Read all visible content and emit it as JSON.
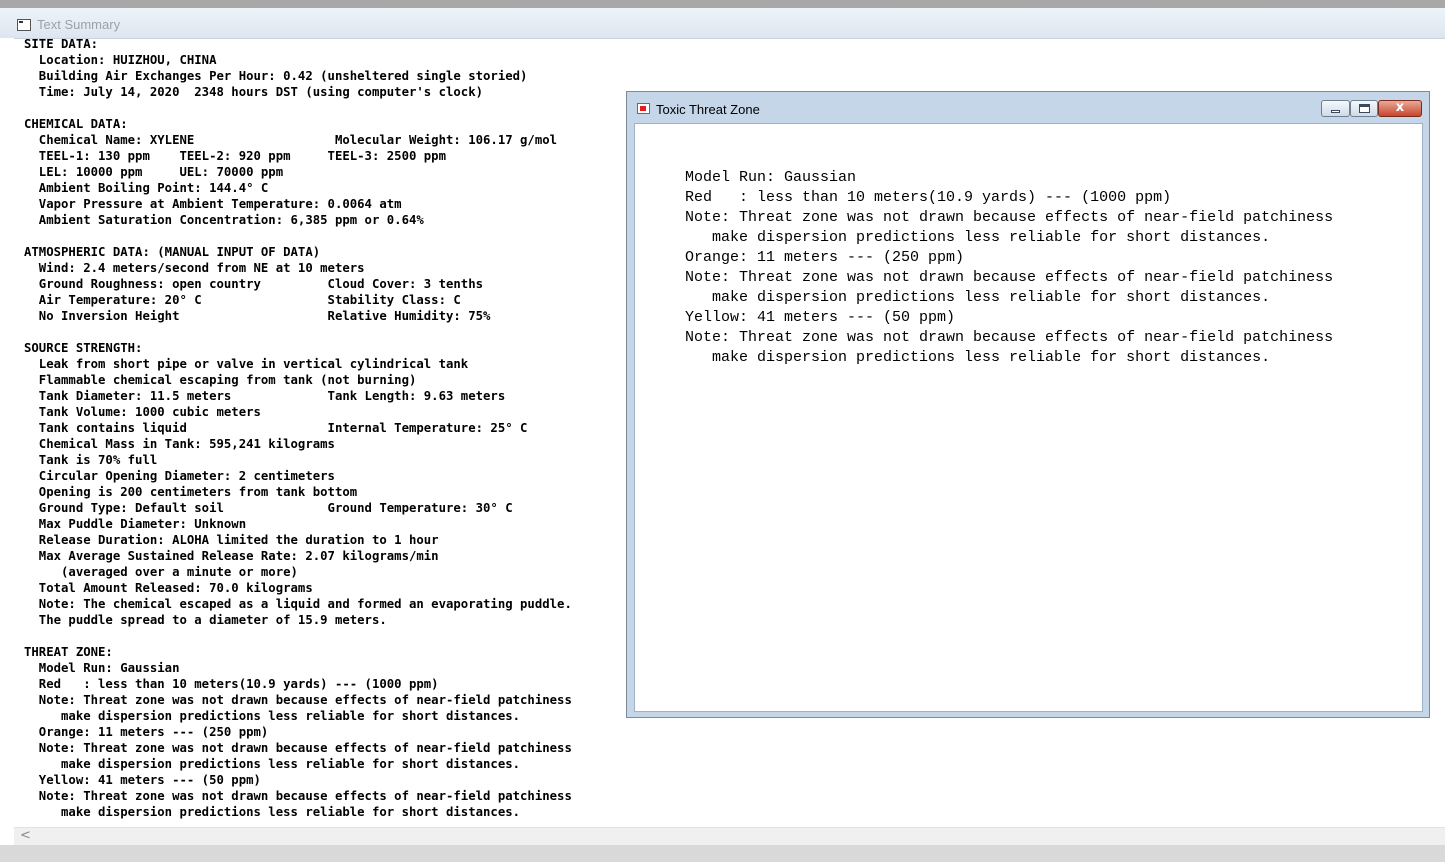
{
  "main_window": {
    "title": "Text Summary",
    "summary_lines": [
      "SITE DATA:",
      "  Location: HUIZHOU, CHINA",
      "  Building Air Exchanges Per Hour: 0.42 (unsheltered single storied)",
      "  Time: July 14, 2020  2348 hours DST (using computer's clock)",
      "",
      "CHEMICAL DATA:",
      "  Chemical Name: XYLENE                   Molecular Weight: 106.17 g/mol",
      "  TEEL-1: 130 ppm    TEEL-2: 920 ppm     TEEL-3: 2500 ppm",
      "  LEL: 10000 ppm     UEL: 70000 ppm",
      "  Ambient Boiling Point: 144.4° C",
      "  Vapor Pressure at Ambient Temperature: 0.0064 atm",
      "  Ambient Saturation Concentration: 6,385 ppm or 0.64%",
      "",
      "ATMOSPHERIC DATA: (MANUAL INPUT OF DATA)",
      "  Wind: 2.4 meters/second from NE at 10 meters",
      "  Ground Roughness: open country         Cloud Cover: 3 tenths",
      "  Air Temperature: 20° C                 Stability Class: C",
      "  No Inversion Height                    Relative Humidity: 75%",
      "",
      "SOURCE STRENGTH:",
      "  Leak from short pipe or valve in vertical cylindrical tank",
      "  Flammable chemical escaping from tank (not burning)",
      "  Tank Diameter: 11.5 meters             Tank Length: 9.63 meters",
      "  Tank Volume: 1000 cubic meters",
      "  Tank contains liquid                   Internal Temperature: 25° C",
      "  Chemical Mass in Tank: 595,241 kilograms",
      "  Tank is 70% full",
      "  Circular Opening Diameter: 2 centimeters",
      "  Opening is 200 centimeters from tank bottom",
      "  Ground Type: Default soil              Ground Temperature: 30° C",
      "  Max Puddle Diameter: Unknown",
      "  Release Duration: ALOHA limited the duration to 1 hour",
      "  Max Average Sustained Release Rate: 2.07 kilograms/min",
      "     (averaged over a minute or more)",
      "  Total Amount Released: 70.0 kilograms",
      "  Note: The chemical escaped as a liquid and formed an evaporating puddle.",
      "  The puddle spread to a diameter of 15.9 meters.",
      "",
      "THREAT ZONE:",
      "  Model Run: Gaussian",
      "  Red   : less than 10 meters(10.9 yards) --- (1000 ppm)",
      "  Note: Threat zone was not drawn because effects of near-field patchiness",
      "     make dispersion predictions less reliable for short distances.",
      "  Orange: 11 meters --- (250 ppm)",
      "  Note: Threat zone was not drawn because effects of near-field patchiness",
      "     make dispersion predictions less reliable for short distances.",
      "  Yellow: 41 meters --- (50 ppm)",
      "  Note: Threat zone was not drawn because effects of near-field patchiness",
      "     make dispersion predictions less reliable for short distances."
    ],
    "scroll_left_arrow": "<"
  },
  "popup_window": {
    "title": "Toxic Threat Zone",
    "close_glyph": "x",
    "lines": [
      "Model Run: Gaussian",
      "Red   : less than 10 meters(10.9 yards) --- (1000 ppm)",
      "Note: Threat zone was not drawn because effects of near-field patchiness",
      "   make dispersion predictions less reliable for short distances.",
      "Orange: 11 meters --- (250 ppm)",
      "Note: Threat zone was not drawn because effects of near-field patchiness",
      "   make dispersion predictions less reliable for short distances.",
      "Yellow: 41 meters --- (50 ppm)",
      "Note: Threat zone was not drawn because effects of near-field patchiness",
      "   make dispersion predictions less reliable for short distances."
    ]
  },
  "colors": {
    "titlebar_text_inactive": "#9aa3ad",
    "close_button": "#c7462c",
    "popup_frame": "#c5d6e8"
  }
}
